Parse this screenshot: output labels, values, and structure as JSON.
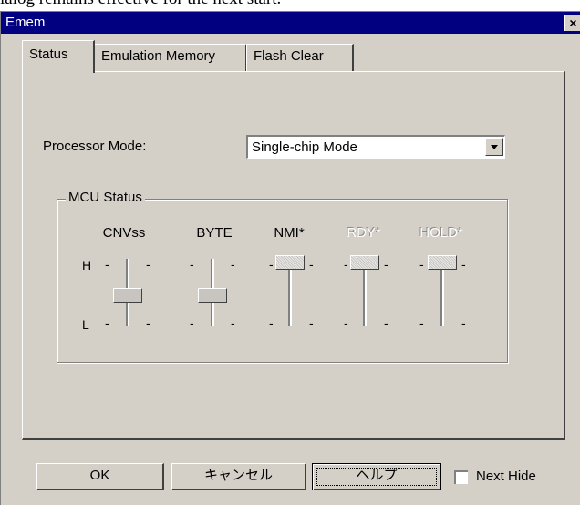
{
  "doc_text": "ialog remains effective for the next start.",
  "dialog": {
    "title": "Emem",
    "close_glyph": "×"
  },
  "tabs": [
    {
      "label": "Status",
      "active": true
    },
    {
      "label": "Emulation Memory",
      "active": false
    },
    {
      "label": "Flash Clear",
      "active": false
    }
  ],
  "status": {
    "processor_mode_label": "Processor Mode:",
    "processor_mode_value": "Single-chip Mode",
    "mcu_status": {
      "title": "MCU Status",
      "scale_high": "H",
      "scale_low": "L",
      "tick": "-",
      "pins": [
        {
          "name": "CNVss",
          "level": "L",
          "enabled": true
        },
        {
          "name": "BYTE",
          "level": "L",
          "enabled": true
        },
        {
          "name": "NMI*",
          "level": "H",
          "enabled": true
        },
        {
          "name": "RDY*",
          "level": "H",
          "enabled": false
        },
        {
          "name": "HOLD*",
          "level": "H",
          "enabled": false
        }
      ]
    }
  },
  "buttons": {
    "ok": "OK",
    "cancel": "キャンセル",
    "help": "ヘルプ"
  },
  "next_hide": {
    "label": "Next Hide",
    "checked": false
  }
}
